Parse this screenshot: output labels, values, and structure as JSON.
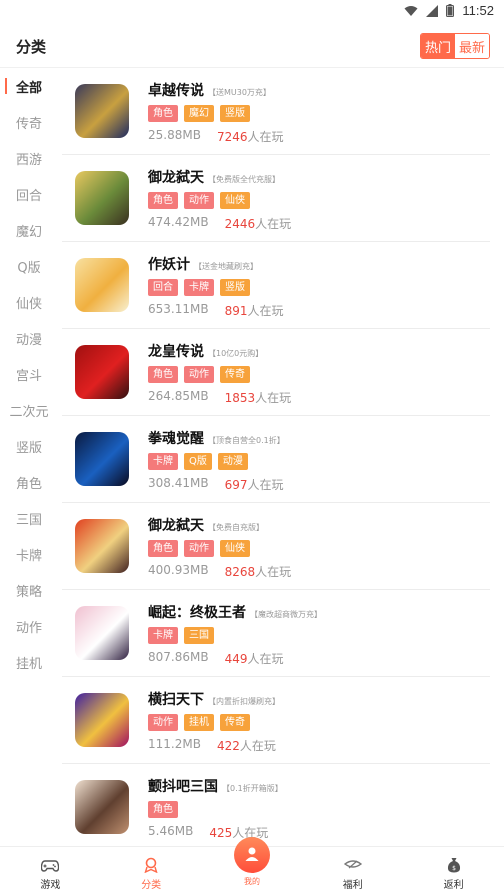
{
  "status_bar": {
    "time": "11:52"
  },
  "header": {
    "title": "分类",
    "sort_hot": "热门",
    "sort_new": "最新"
  },
  "sidebar": {
    "items": [
      {
        "label": "全部",
        "active": true
      },
      {
        "label": "传奇"
      },
      {
        "label": "西游"
      },
      {
        "label": "回合"
      },
      {
        "label": "魔幻"
      },
      {
        "label": "Q版"
      },
      {
        "label": "仙侠"
      },
      {
        "label": "动漫"
      },
      {
        "label": "宫斗"
      },
      {
        "label": "二次元"
      },
      {
        "label": "竖版"
      },
      {
        "label": "角色"
      },
      {
        "label": "三国"
      },
      {
        "label": "卡牌"
      },
      {
        "label": "策略"
      },
      {
        "label": "动作"
      },
      {
        "label": "挂机"
      }
    ]
  },
  "colors": {
    "accent": "#ff6a4a",
    "tag_pink": "#f47a7a",
    "tag_orange": "#f7a23b",
    "players_red": "#e8453c"
  },
  "games": [
    {
      "name": "卓越传说",
      "note": "【送MU30万充】",
      "tags": [
        "角色",
        "魔幻",
        "竖版"
      ],
      "size": "25.88MB",
      "players": "7246",
      "players_suffix": "人在玩",
      "icon_colors": [
        "#3a3a5a",
        "#c8a040",
        "#1e2a60"
      ]
    },
    {
      "name": "御龙弑天",
      "note": "【免费版全代充服】",
      "tags": [
        "角色",
        "动作",
        "仙侠"
      ],
      "size": "474.42MB",
      "players": "2446",
      "players_suffix": "人在玩",
      "icon_colors": [
        "#e8c860",
        "#6a8a3a",
        "#3a3020"
      ]
    },
    {
      "name": "作妖计",
      "note": "【送金地藏刷充】",
      "tags": [
        "回合",
        "卡牌",
        "竖版"
      ],
      "size": "653.11MB",
      "players": "891",
      "players_suffix": "人在玩",
      "icon_colors": [
        "#f8e0a0",
        "#f0b040",
        "#f8f0d0"
      ]
    },
    {
      "name": "龙皇传说",
      "note": "【10亿0元购】",
      "tags": [
        "角色",
        "动作",
        "传奇"
      ],
      "size": "264.85MB",
      "players": "1853",
      "players_suffix": "人在玩",
      "icon_colors": [
        "#a01010",
        "#e02020",
        "#301010"
      ]
    },
    {
      "name": "拳魂觉醒",
      "note": "【顶食自营全0.1折】",
      "tags": [
        "卡牌",
        "Q版",
        "动漫"
      ],
      "size": "308.41MB",
      "players": "697",
      "players_suffix": "人在玩",
      "icon_colors": [
        "#0a1a40",
        "#1a60c0",
        "#0a0a20"
      ]
    },
    {
      "name": "御龙弑天",
      "note": "【免费自充版】",
      "tags": [
        "角色",
        "动作",
        "仙侠"
      ],
      "size": "400.93MB",
      "players": "8268",
      "players_suffix": "人在玩",
      "icon_colors": [
        "#e04020",
        "#f0d080",
        "#402020"
      ]
    },
    {
      "name": "崛起：终极王者",
      "note": "【魔改超商微万充】",
      "tags": [
        "卡牌",
        "三国"
      ],
      "size": "807.86MB",
      "players": "449",
      "players_suffix": "人在玩",
      "icon_colors": [
        "#f0c0d0",
        "#ffffff",
        "#302040"
      ]
    },
    {
      "name": "横扫天下",
      "note": "【内置折扣爆刷充】",
      "tags": [
        "动作",
        "挂机",
        "传奇"
      ],
      "size": "111.2MB",
      "players": "422",
      "players_suffix": "人在玩",
      "icon_colors": [
        "#4020a0",
        "#f0c040",
        "#a01060"
      ]
    },
    {
      "name": "颤抖吧三国",
      "note": "【0.1折开箱版】",
      "tags": [
        "角色"
      ],
      "size": "5.46MB",
      "players": "425",
      "players_suffix": "人在玩",
      "icon_colors": [
        "#f0e0d0",
        "#604030",
        "#c09070"
      ]
    }
  ],
  "bottom_nav": {
    "items": [
      {
        "label": "游戏",
        "icon": "gamepad-icon"
      },
      {
        "label": "分类",
        "icon": "category-icon",
        "active": true
      },
      {
        "label": "我的",
        "icon": "user-icon",
        "center": true
      },
      {
        "label": "福利",
        "icon": "gift-icon"
      },
      {
        "label": "返利",
        "icon": "money-bag-icon"
      }
    ]
  }
}
